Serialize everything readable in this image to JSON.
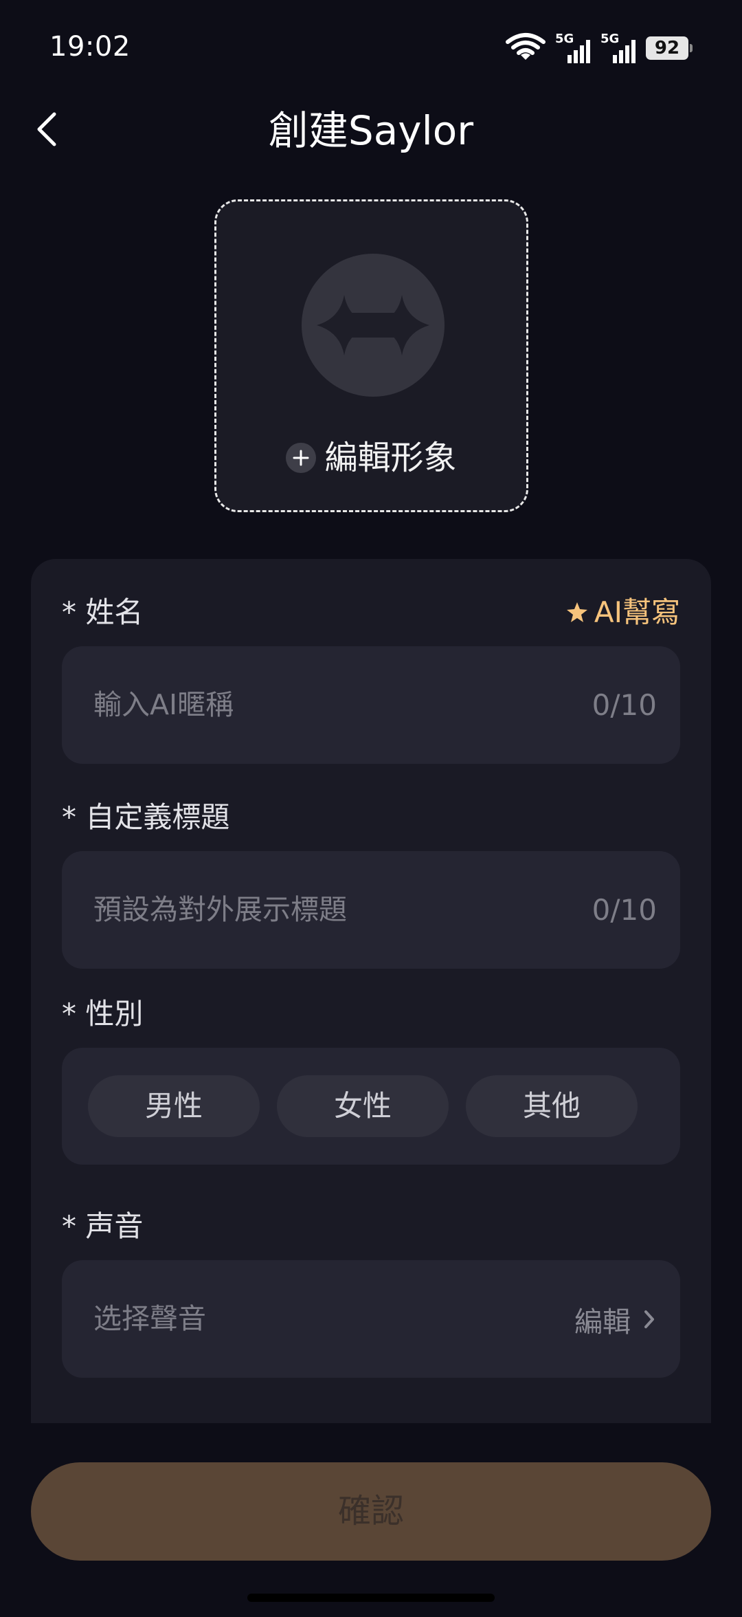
{
  "status_bar": {
    "time": "19:02",
    "network_1": "5G",
    "network_2": "5G",
    "battery": "92"
  },
  "header": {
    "title": "創建Saylor"
  },
  "avatar": {
    "edit_label": "編輯形象"
  },
  "form": {
    "name": {
      "label": "* 姓名",
      "ai_write_label": "AI幫寫",
      "placeholder": "輸入AI暱稱",
      "count": "0/10"
    },
    "custom_title": {
      "label": "* 自定義標題",
      "placeholder": "預設為對外展示標題",
      "count": "0/10"
    },
    "gender": {
      "label": "* 性別",
      "options": [
        "男性",
        "女性",
        "其他"
      ]
    },
    "voice": {
      "label": "* 声音",
      "placeholder": "选择聲音",
      "edit_label": "編輯"
    }
  },
  "confirm_label": "確認",
  "colors": {
    "background": "#0d0d17",
    "card": "#1a1a25",
    "input": "#252532",
    "accent": "#f6c37c",
    "confirm_button": "#5a4636"
  }
}
